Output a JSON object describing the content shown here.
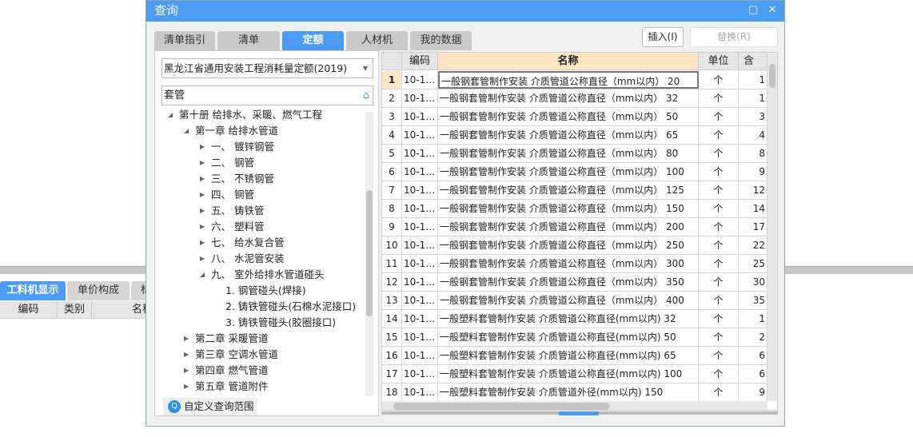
{
  "background": {
    "tabs": [
      "工料机显示",
      "单价构成",
      "标"
    ],
    "headers": [
      "编码",
      "类别",
      "名称"
    ]
  },
  "dialog": {
    "title": "查询",
    "tabs": [
      "清单指引",
      "清单",
      "定额",
      "人材机",
      "我的数据"
    ],
    "active_tab": "定额",
    "insert_button": "插入(I)",
    "replace_button": "替换(R)",
    "quota_library": "黑龙江省通用安装工程消耗量定额(2019)",
    "search_value": "套管",
    "custom_scope": "自定义查询范围",
    "tree": [
      {
        "label": "第十册 给排水、采暖、燃气工程",
        "level": 0,
        "expanded": true
      },
      {
        "label": "第一章 给排水管道",
        "level": 1,
        "expanded": true
      },
      {
        "label": "一、 镀锌钢管",
        "level": 2,
        "expanded": false
      },
      {
        "label": "二、 钢管",
        "level": 2,
        "expanded": false
      },
      {
        "label": "三、 不锈钢管",
        "level": 2,
        "expanded": false
      },
      {
        "label": "四、 铜管",
        "level": 2,
        "expanded": false
      },
      {
        "label": "五、 铸铁管",
        "level": 2,
        "expanded": false
      },
      {
        "label": "六、 塑料管",
        "level": 2,
        "expanded": false
      },
      {
        "label": "七、 给水复合管",
        "level": 2,
        "expanded": false
      },
      {
        "label": "八、 水泥管安装",
        "level": 2,
        "expanded": false
      },
      {
        "label": "九、 室外给排水管道碰头",
        "level": 2,
        "expanded": true
      },
      {
        "label": "1. 钢管碰头(焊接)",
        "level": 3
      },
      {
        "label": "2. 铸铁管碰头(石棉水泥接口)",
        "level": 3
      },
      {
        "label": "3. 铸铁管碰头(胶圈接口)",
        "level": 3
      },
      {
        "label": "第二章 采暖管道",
        "level": 1,
        "expanded": false
      },
      {
        "label": "第三章 空调水管道",
        "level": 1,
        "expanded": false
      },
      {
        "label": "第四章 燃气管道",
        "level": 1,
        "expanded": false
      },
      {
        "label": "第五章 管道附件",
        "level": 1,
        "expanded": false
      }
    ],
    "grid": {
      "headers": [
        "",
        "编码",
        "名称",
        "单位",
        "含税!"
      ],
      "rows": [
        [
          "1",
          "10-1…",
          "一般钢套管制作安装 介质管道公称直径（mm以内） 20",
          "个",
          "1"
        ],
        [
          "2",
          "10-1…",
          "一般钢套管制作安装 介质管道公称直径（mm以内） 32",
          "个",
          "1"
        ],
        [
          "3",
          "10-1…",
          "一般钢套管制作安装 介质管道公称直径（mm以内） 50",
          "个",
          "3"
        ],
        [
          "4",
          "10-1…",
          "一般钢套管制作安装 介质管道公称直径（mm以内） 65",
          "个",
          "4"
        ],
        [
          "5",
          "10-1…",
          "一般钢套管制作安装 介质管道公称直径（mm以内） 80",
          "个",
          "8"
        ],
        [
          "6",
          "10-1…",
          "一般钢套管制作安装 介质管道公称直径（mm以内） 100",
          "个",
          "9"
        ],
        [
          "7",
          "10-1…",
          "一般钢套管制作安装 介质管道公称直径（mm以内） 125",
          "个",
          "12"
        ],
        [
          "8",
          "10-1…",
          "一般钢套管制作安装 介质管道公称直径（mm以内） 150",
          "个",
          "14"
        ],
        [
          "9",
          "10-1…",
          "一般钢套管制作安装 介质管道公称直径（mm以内） 200",
          "个",
          "17"
        ],
        [
          "10",
          "10-1…",
          "一般钢套管制作安装 介质管道公称直径（mm以内） 250",
          "个",
          "22"
        ],
        [
          "11",
          "10-1…",
          "一般钢套管制作安装 介质管道公称直径（mm以内） 300",
          "个",
          "25"
        ],
        [
          "12",
          "10-1…",
          "一般钢套管制作安装 介质管道公称直径（mm以内） 350",
          "个",
          "30"
        ],
        [
          "13",
          "10-1…",
          "一般钢套管制作安装 介质管道公称直径（mm以内） 400",
          "个",
          "35"
        ],
        [
          "14",
          "10-1…",
          "一般塑料套管制作安装 介质管道公称直径(mm以内) 32",
          "个",
          "1"
        ],
        [
          "15",
          "10-1…",
          "一般塑料套管制作安装 介质管道公称直径(mm以内) 50",
          "个",
          "2"
        ],
        [
          "16",
          "10-1…",
          "一般塑料套管制作安装 介质管道公称直径(mm以内) 65",
          "个",
          "6"
        ],
        [
          "17",
          "10-1…",
          "一般塑料套管制作安装 介质管道公称直径(mm以内) 100",
          "个",
          "6"
        ],
        [
          "18",
          "10-1…",
          "一般塑料套管制作安装 介质管道外径(mm以内) 150",
          "个",
          "9"
        ]
      ]
    }
  },
  "colors": {
    "accent": "#4a9cf6",
    "header_highlight": "#fde5c4"
  }
}
